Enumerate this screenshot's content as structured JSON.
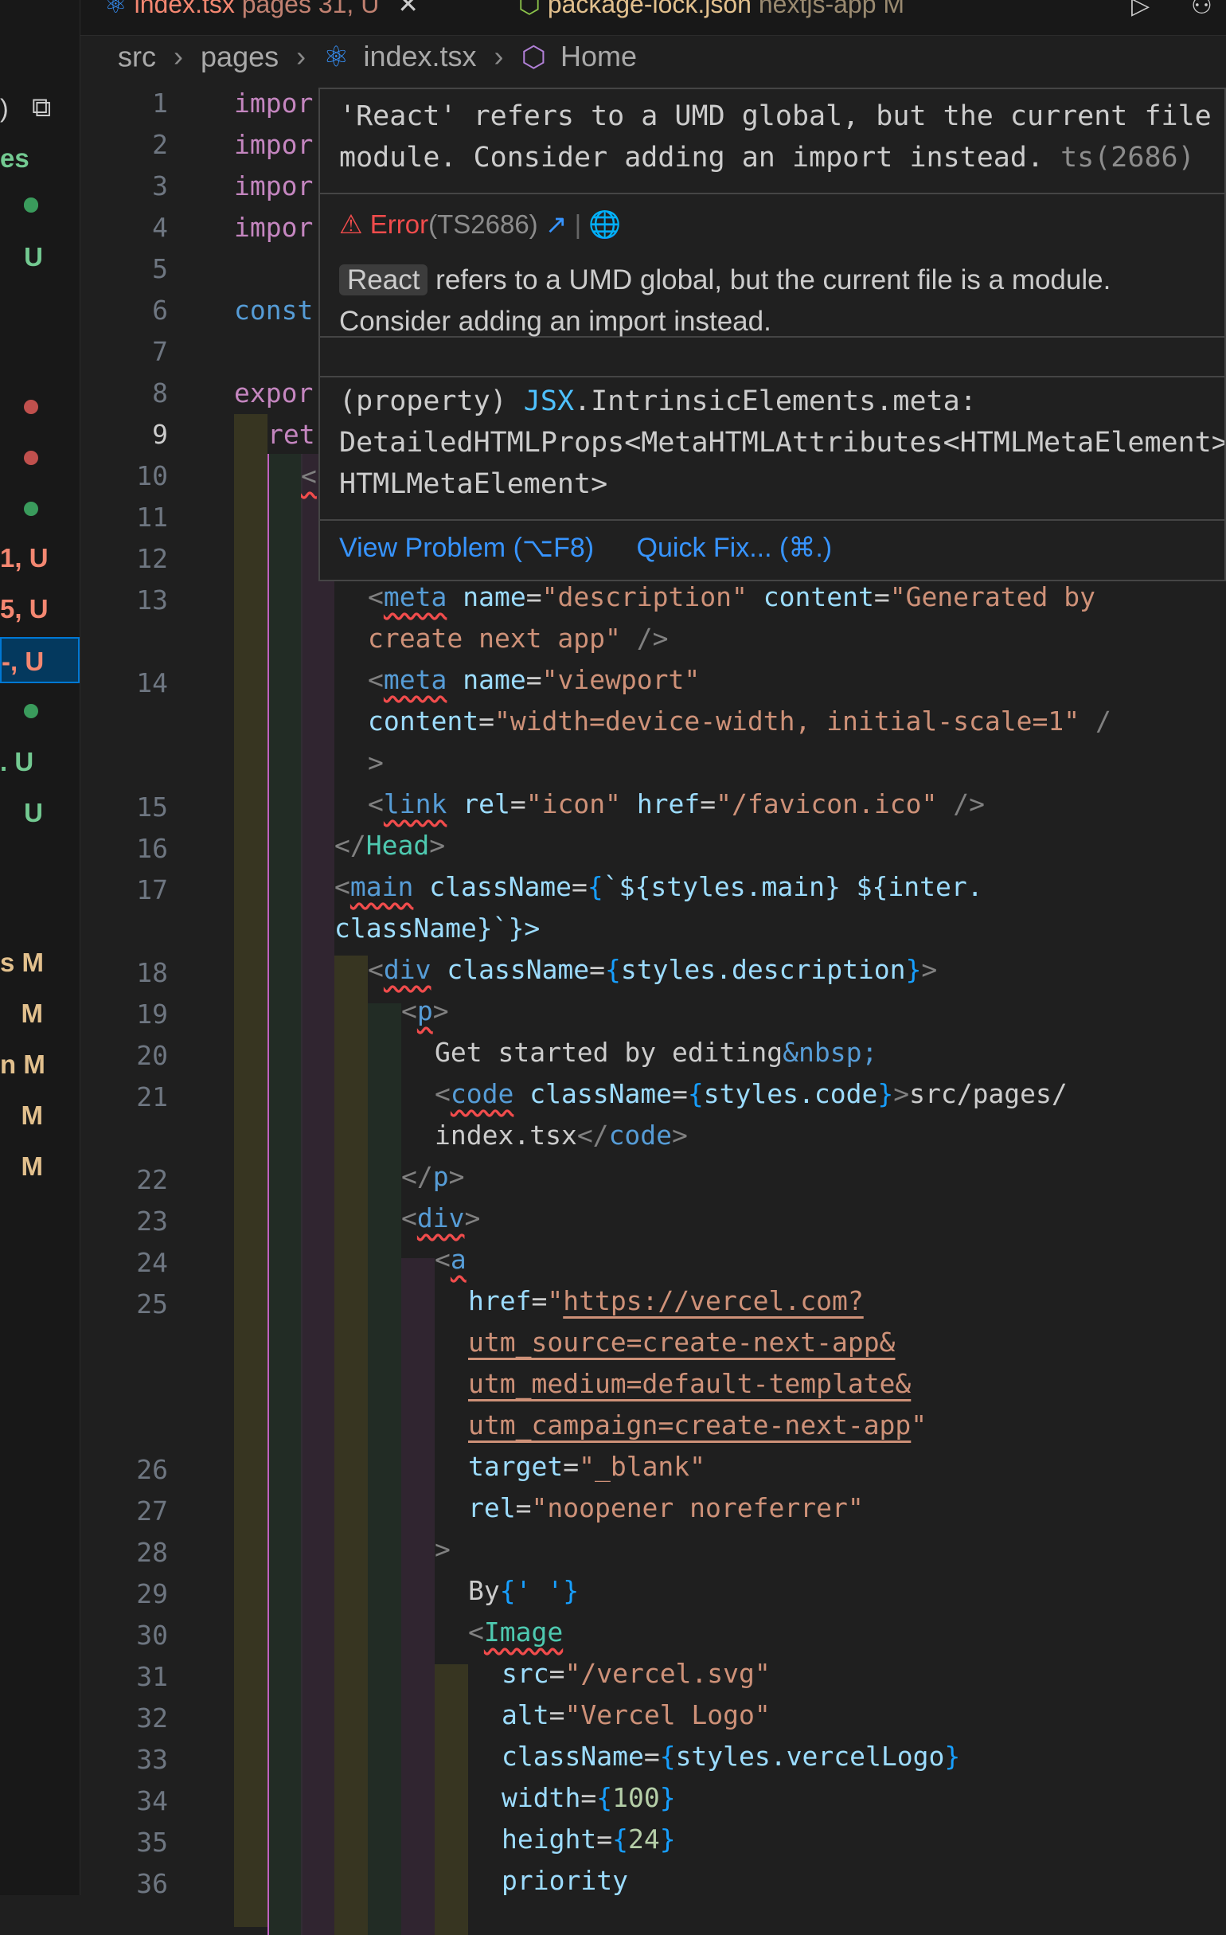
{
  "tabs": [
    {
      "label": "index.tsx",
      "detail": "pages 31, U"
    },
    {
      "label": "package-lock.json",
      "detail": "nextjs-app M"
    }
  ],
  "breadcrumb": {
    "items": [
      "src",
      "pages",
      "index.tsx",
      "Home"
    ]
  },
  "sidebar": {
    "rows": [
      {
        "left": "",
        "badge": "",
        "dot": "#3a9b5c"
      },
      {
        "left": "es",
        "badge": "",
        "dot": ""
      },
      {
        "left": "",
        "badge": "",
        "dot": "#3a9b5c"
      },
      {
        "left": "",
        "badge": "U",
        "dot": ""
      },
      {
        "left": "",
        "badge": "",
        "dot": "#c0504d"
      },
      {
        "left": "",
        "badge": "",
        "dot": "#c0504d"
      },
      {
        "left": "",
        "badge": "",
        "dot": "#3a9b5c"
      },
      {
        "left": "1, U",
        "badge": "",
        "dot": ""
      },
      {
        "left": "5, U",
        "badge": "",
        "dot": ""
      },
      {
        "left": "-, U",
        "badge": "",
        "dot": ""
      },
      {
        "left": "",
        "badge": "",
        "dot": "#3a9b5c"
      },
      {
        "left": ". U",
        "badge": "",
        "dot": ""
      },
      {
        "left": "",
        "badge": "U",
        "dot": ""
      },
      {
        "left": "s M",
        "badge": "",
        "dot": ""
      },
      {
        "left": "",
        "badge": "M",
        "dot": ""
      },
      {
        "left": "n M",
        "badge": "",
        "dot": ""
      },
      {
        "left": "",
        "badge": "M",
        "dot": ""
      },
      {
        "left": "",
        "badge": "M",
        "dot": ""
      }
    ]
  },
  "line_numbers": [
    "1",
    "2",
    "3",
    "4",
    "5",
    "6",
    "7",
    "8",
    "9",
    "10",
    "11",
    "12",
    "13",
    "",
    "14",
    "",
    "",
    "15",
    "16",
    "17",
    "",
    "18",
    "19",
    "20",
    "21",
    "",
    "22",
    "23",
    "24",
    "25",
    "",
    "",
    "",
    "26",
    "27",
    "28",
    "29",
    "30",
    "31",
    "32",
    "33",
    "34",
    "35",
    "36"
  ],
  "code_partial": {
    "l1": "impor",
    "l2": "impor",
    "l3": "impor",
    "l4": "impor",
    "l6": "const",
    "l8": "expor",
    "l9": "ret",
    "l10": "<"
  },
  "code": {
    "l13a_tag": "meta",
    "l13a_attr1": "name",
    "l13a_val1": "\"description\"",
    "l13a_attr2": "content",
    "l13a_val2": "\"Generated by",
    "l13b": "create next app\"",
    "l14a_tag": "meta",
    "l14a_attr": "name",
    "l14a_val": "\"viewport\"",
    "l14b_attr": "content",
    "l14b_val": "\"width=device-width, initial-scale=1\"",
    "l14c": ">",
    "l15_tag": "link",
    "l15_attr1": "rel",
    "l15_val1": "\"icon\"",
    "l15_attr2": "href",
    "l15_val2": "\"/favicon.ico\"",
    "l16_tag": "Head",
    "l17_tag": "main",
    "l17_attr": "className",
    "l17_expr": "`${styles.main} ${inter.",
    "l17b": "className}`}>",
    "l18_tag": "div",
    "l18_attr": "className",
    "l18_expr": "styles.description",
    "l19_tag": "p",
    "l20_text": "Get started by editing",
    "l20_ent": "&nbsp;",
    "l21_tag": "code",
    "l21_attr": "className",
    "l21_expr": "styles.code",
    "l21_text": "src/pages/",
    "l21b_text": "index.tsx",
    "l21b_tag": "code",
    "l22_tag": "p",
    "l23_tag": "div",
    "l24_tag": "a",
    "l25_attr": "href",
    "l25_val1": "https://vercel.com?",
    "l25_val2": "utm_source=create-next-app&",
    "l25_val3": "utm_medium=default-template&",
    "l25_val4": "utm_campaign=create-next-app",
    "l26_attr": "target",
    "l26_val": "\"_blank\"",
    "l27_attr": "rel",
    "l27_val": "\"noopener noreferrer\"",
    "l28": ">",
    "l29_text": "By",
    "l29_expr": "{' '}",
    "l30_tag": "Image",
    "l31_attr": "src",
    "l31_val": "\"/vercel.svg\"",
    "l32_attr": "alt",
    "l32_val": "\"Vercel Logo\"",
    "l33_attr": "className",
    "l33_expr": "styles.vercelLogo",
    "l34_attr": "width",
    "l34_num": "100",
    "l35_attr": "height",
    "l35_num": "24",
    "l36_attr": "priority"
  },
  "hover": {
    "message_line1": "'React' refers to a UMD global, but the current file is a",
    "message_line2": "module. Consider adding an import instead.",
    "message_code": "ts(2686)",
    "error_label": "Error",
    "error_code": "(TS2686)",
    "desc_chip": "React",
    "desc_rest": " refers to a UMD global, but the current file is a module.",
    "desc_line2": "Consider adding an import instead.",
    "sig_line1_a": "(property) ",
    "sig_line1_b": "JSX",
    "sig_line1_c": ".IntrinsicElements.meta:",
    "sig_line2": "DetailedHTMLProps<MetaHTMLAttributes<HTMLMetaElement>,",
    "sig_line3": "HTMLMetaElement>",
    "view_problem": "View Problem (⌥F8)",
    "quick_fix": "Quick Fix... (⌘.)"
  },
  "colors": {
    "error": "#f14c4c",
    "link": "#3794ff",
    "git_untracked": "#73c991",
    "git_modified": "#e2c08d",
    "git_error": "#f48771"
  }
}
